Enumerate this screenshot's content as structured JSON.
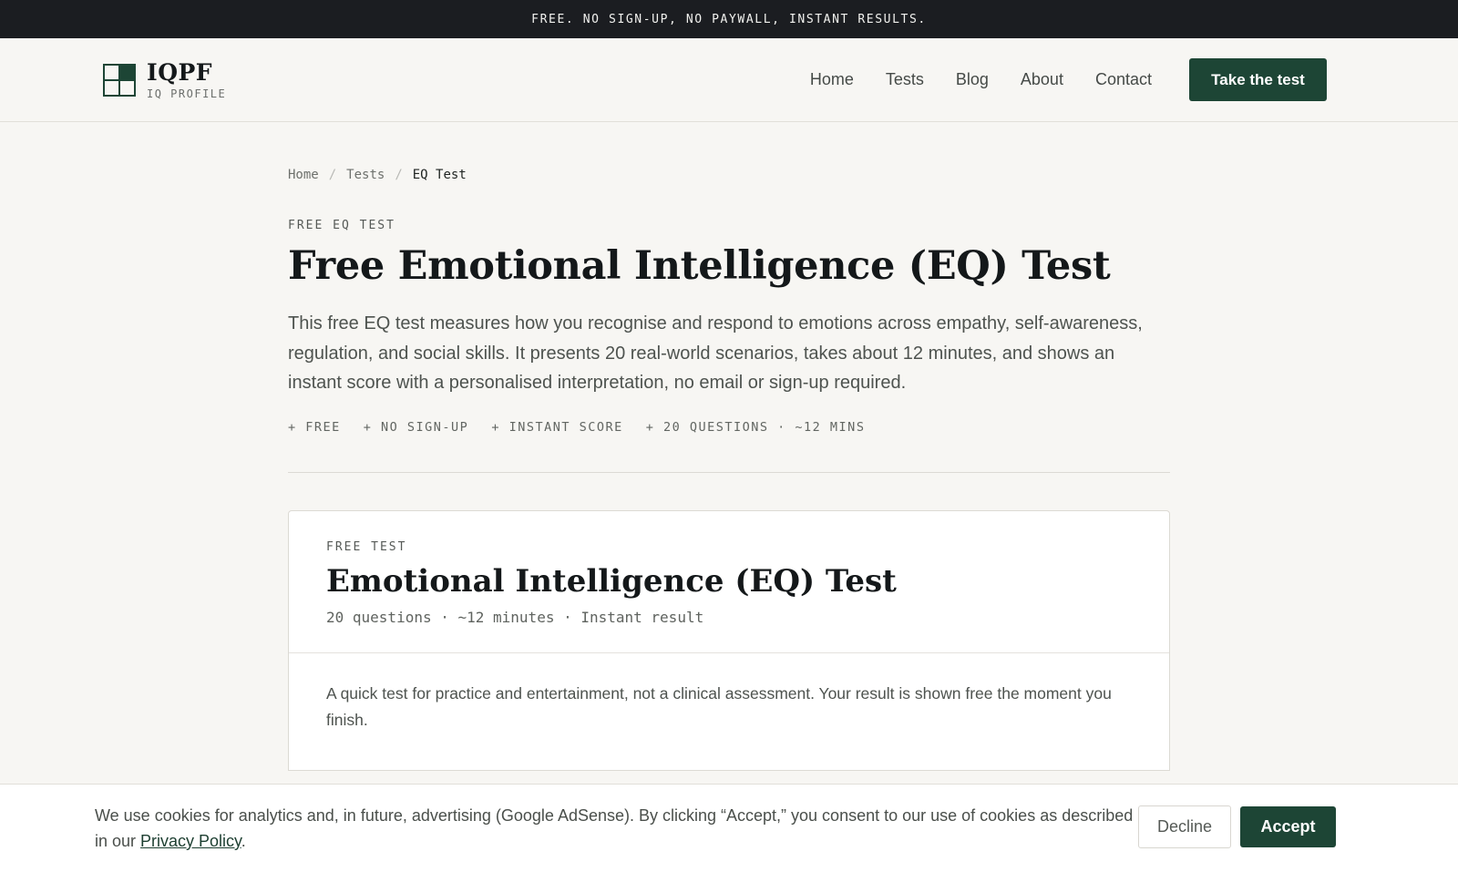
{
  "topbar": {
    "text": "FREE. NO SIGN-UP, NO PAYWALL, INSTANT RESULTS."
  },
  "brand": {
    "title": "IQPF",
    "subtitle": "IQ PROFILE",
    "color": "#1d4535"
  },
  "nav": {
    "items": [
      {
        "label": "Home"
      },
      {
        "label": "Tests"
      },
      {
        "label": "Blog"
      },
      {
        "label": "About"
      },
      {
        "label": "Contact"
      }
    ],
    "cta_label": "Take the test"
  },
  "breadcrumb": {
    "home": "Home",
    "tests": "Tests",
    "current": "EQ Test",
    "separator": "/"
  },
  "hero": {
    "eyebrow": "FREE EQ TEST",
    "title": "Free Emotional Intelligence (EQ) Test",
    "lead": "This free EQ test measures how you recognise and respond to emotions across empathy, self-awareness, regulation, and social skills. It presents 20 real-world scenarios, takes about 12 minutes, and shows an instant score with a personalised interpretation, no email or sign-up required.",
    "chips": [
      "+ FREE",
      "+ NO SIGN-UP",
      "+ INSTANT SCORE",
      "+ 20 QUESTIONS · ~12 MINS"
    ]
  },
  "card": {
    "eyebrow": "FREE TEST",
    "title": "Emotional Intelligence (EQ) Test",
    "meta": "20 questions · ~12 minutes · Instant result",
    "description": "A quick test for practice and entertainment, not a clinical assessment. Your result is shown free the moment you finish."
  },
  "cookie": {
    "text_before": "We use cookies for analytics and, in future, advertising (Google AdSense). By clicking “Accept,” you consent to our use of cookies as described in our ",
    "link": "Privacy Policy",
    "text_after": ".",
    "decline_label": "Decline",
    "accept_label": "Accept"
  }
}
